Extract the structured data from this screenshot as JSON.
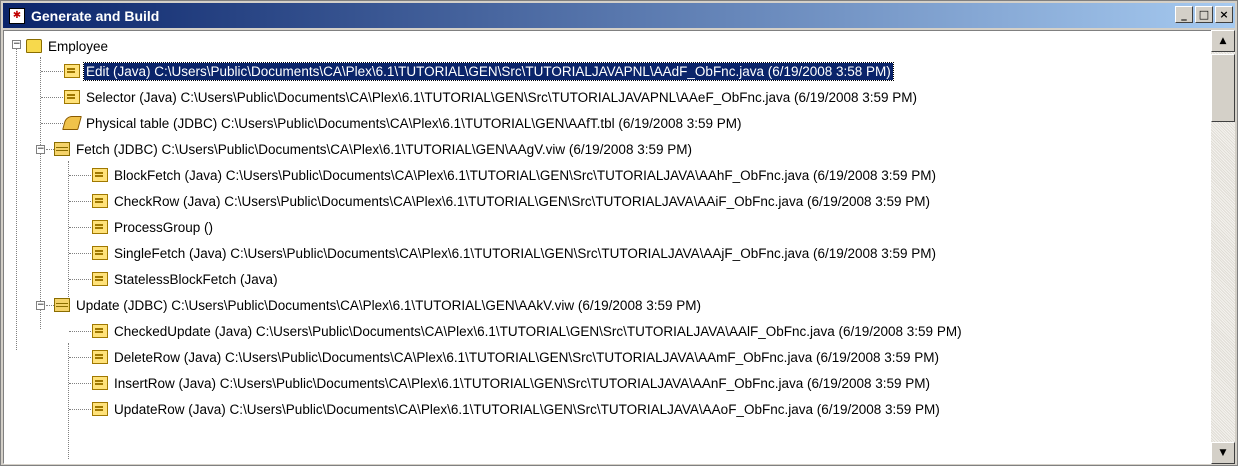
{
  "window": {
    "title": "Generate and Build",
    "minimize": "_",
    "maximize": "□",
    "close": "×"
  },
  "tree": {
    "root": "Employee",
    "items": [
      {
        "label": "Edit (Java) C:\\Users\\Public\\Documents\\CA\\Plex\\6.1\\TUTORIAL\\GEN\\Src\\TUTORIALJAVAPNL\\AAdF_ObFnc.java (6/19/2008 3:58 PM)",
        "icon": "function-icon",
        "selected": true
      },
      {
        "label": "Selector (Java) C:\\Users\\Public\\Documents\\CA\\Plex\\6.1\\TUTORIAL\\GEN\\Src\\TUTORIALJAVAPNL\\AAeF_ObFnc.java (6/19/2008 3:59 PM)",
        "icon": "function-icon"
      },
      {
        "label": "Physical table (JDBC) C:\\Users\\Public\\Documents\\CA\\Plex\\6.1\\TUTORIAL\\GEN\\AAfT.tbl (6/19/2008 3:59 PM)",
        "icon": "table-icon"
      },
      {
        "label": "Fetch (JDBC) C:\\Users\\Public\\Documents\\CA\\Plex\\6.1\\TUTORIAL\\GEN\\AAgV.viw (6/19/2008 3:59 PM)",
        "icon": "view-icon"
      },
      {
        "label": "BlockFetch (Java) C:\\Users\\Public\\Documents\\CA\\Plex\\6.1\\TUTORIAL\\GEN\\Src\\TUTORIALJAVA\\AAhF_ObFnc.java (6/19/2008 3:59 PM)",
        "icon": "function-icon"
      },
      {
        "label": "CheckRow (Java) C:\\Users\\Public\\Documents\\CA\\Plex\\6.1\\TUTORIAL\\GEN\\Src\\TUTORIALJAVA\\AAiF_ObFnc.java (6/19/2008 3:59 PM)",
        "icon": "function-icon"
      },
      {
        "label": "ProcessGroup ()",
        "icon": "function-icon"
      },
      {
        "label": "SingleFetch (Java) C:\\Users\\Public\\Documents\\CA\\Plex\\6.1\\TUTORIAL\\GEN\\Src\\TUTORIALJAVA\\AAjF_ObFnc.java (6/19/2008 3:59 PM)",
        "icon": "function-icon"
      },
      {
        "label": "StatelessBlockFetch (Java)",
        "icon": "function-icon"
      },
      {
        "label": "Update (JDBC) C:\\Users\\Public\\Documents\\CA\\Plex\\6.1\\TUTORIAL\\GEN\\AAkV.viw (6/19/2008 3:59 PM)",
        "icon": "view-icon"
      },
      {
        "label": "CheckedUpdate (Java) C:\\Users\\Public\\Documents\\CA\\Plex\\6.1\\TUTORIAL\\GEN\\Src\\TUTORIALJAVA\\AAlF_ObFnc.java (6/19/2008 3:59 PM)",
        "icon": "function-icon"
      },
      {
        "label": "DeleteRow (Java) C:\\Users\\Public\\Documents\\CA\\Plex\\6.1\\TUTORIAL\\GEN\\Src\\TUTORIALJAVA\\AAmF_ObFnc.java (6/19/2008 3:59 PM)",
        "icon": "function-icon"
      },
      {
        "label": "InsertRow (Java) C:\\Users\\Public\\Documents\\CA\\Plex\\6.1\\TUTORIAL\\GEN\\Src\\TUTORIALJAVA\\AAnF_ObFnc.java (6/19/2008 3:59 PM)",
        "icon": "function-icon"
      },
      {
        "label": "UpdateRow (Java) C:\\Users\\Public\\Documents\\CA\\Plex\\6.1\\TUTORIAL\\GEN\\Src\\TUTORIALJAVA\\AAoF_ObFnc.java (6/19/2008 3:59 PM)",
        "icon": "function-icon"
      }
    ]
  },
  "scrollbar": {
    "up": "▲",
    "down": "▼"
  }
}
